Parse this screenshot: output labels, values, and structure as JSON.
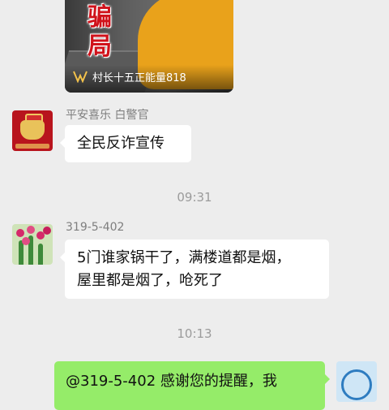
{
  "video_card": {
    "overlay_line1": "骗",
    "overlay_line2": "局",
    "channel_icon": "channels-icon",
    "channel_name": "村长十五正能量818",
    "badge_icon": "verified-badge-icon"
  },
  "messages": [
    {
      "sender": "平安喜乐 白警官",
      "text": "全民反诈宣传",
      "side": "left"
    },
    {
      "sender": "319-5-402",
      "text_line1": "5门谁家锅干了，满楼道都是烟，",
      "text_line2": "屋里都是烟了，呛死了",
      "side": "left"
    },
    {
      "text": "@319-5-402  感谢您的提醒，我",
      "side": "right"
    }
  ],
  "timestamps": [
    "09:31",
    "10:13"
  ],
  "colors": {
    "background": "#ededed",
    "own_bubble": "#95ec69",
    "other_bubble": "#ffffff"
  }
}
